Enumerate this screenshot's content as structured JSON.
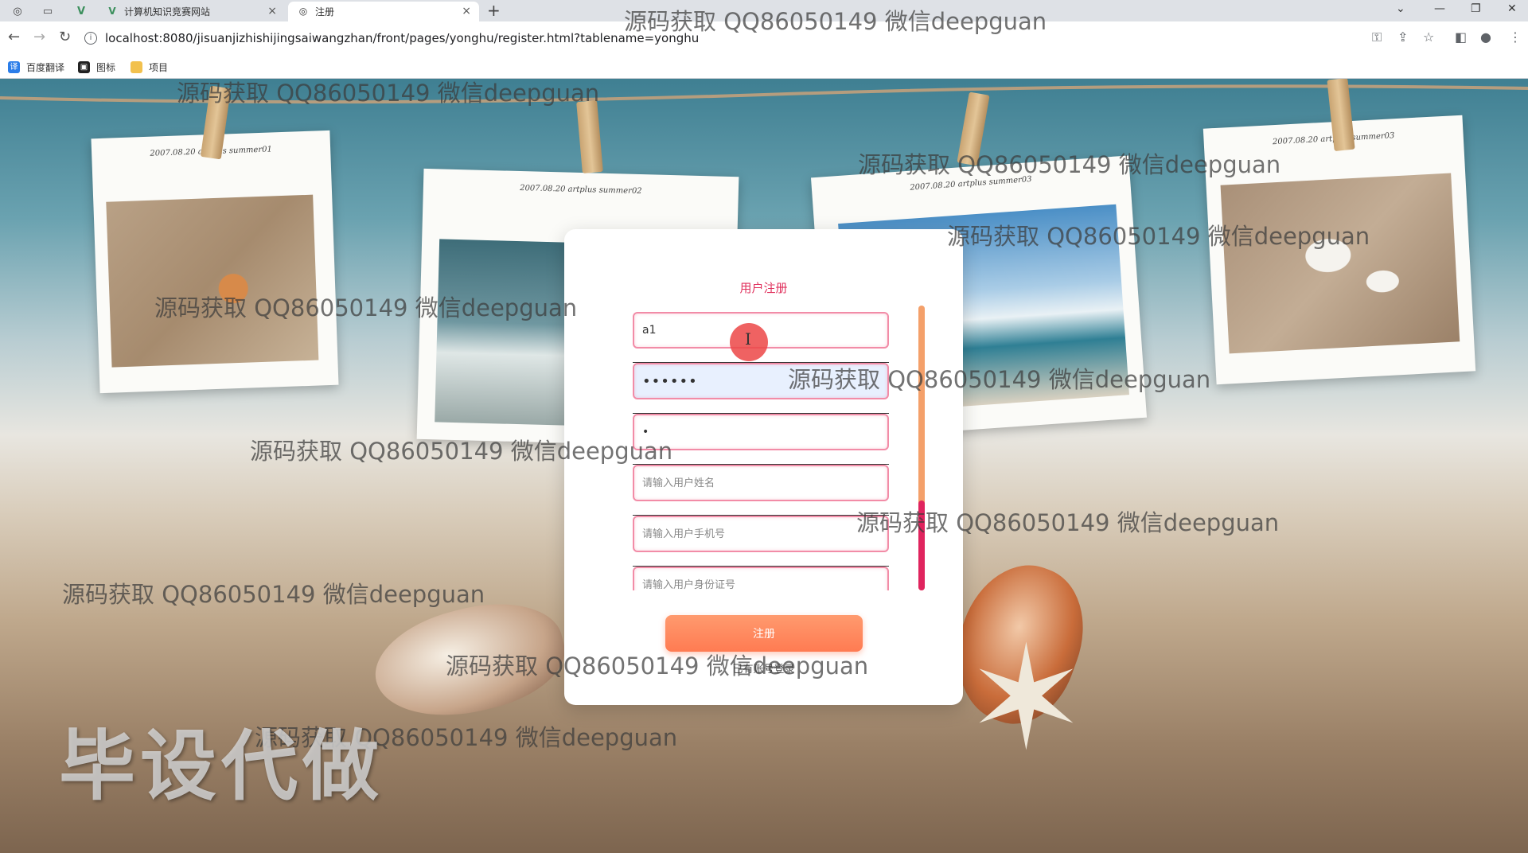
{
  "browser": {
    "tabs": [
      {
        "title": "计算机知识竞赛网站",
        "active": false
      },
      {
        "title": "注册",
        "active": true
      }
    ],
    "url": "localhost:8080/jisuanjizhishijingsaiwangzhan/front/pages/yonghu/register.html?tablename=yonghu",
    "bookmarks": [
      "百度翻译",
      "图标",
      "项目"
    ]
  },
  "photos": [
    {
      "caption": "2007.08.20 artplus summer01"
    },
    {
      "caption": "2007.08.20 artplus summer02"
    },
    {
      "caption": "2007.08.20 artplus summer03"
    },
    {
      "caption": "2007.08.20 artplus summer03"
    }
  ],
  "form": {
    "title": "用户注册",
    "account_value": "a1",
    "password_value": "••••••",
    "confirm_value": "•",
    "name_placeholder": "请输入用户姓名",
    "phone_placeholder": "请输入用户手机号",
    "idcard_placeholder": "请输入用户身份证号",
    "submit_label": "注册",
    "login_link": "已有账号登录"
  },
  "watermarks": {
    "text": "源码获取 QQ86050149 微信deepguan",
    "big_text": "毕设代做"
  },
  "colors": {
    "accent": "#e0315d",
    "button": "#ff7b52",
    "field_border": "#f28ca7"
  }
}
